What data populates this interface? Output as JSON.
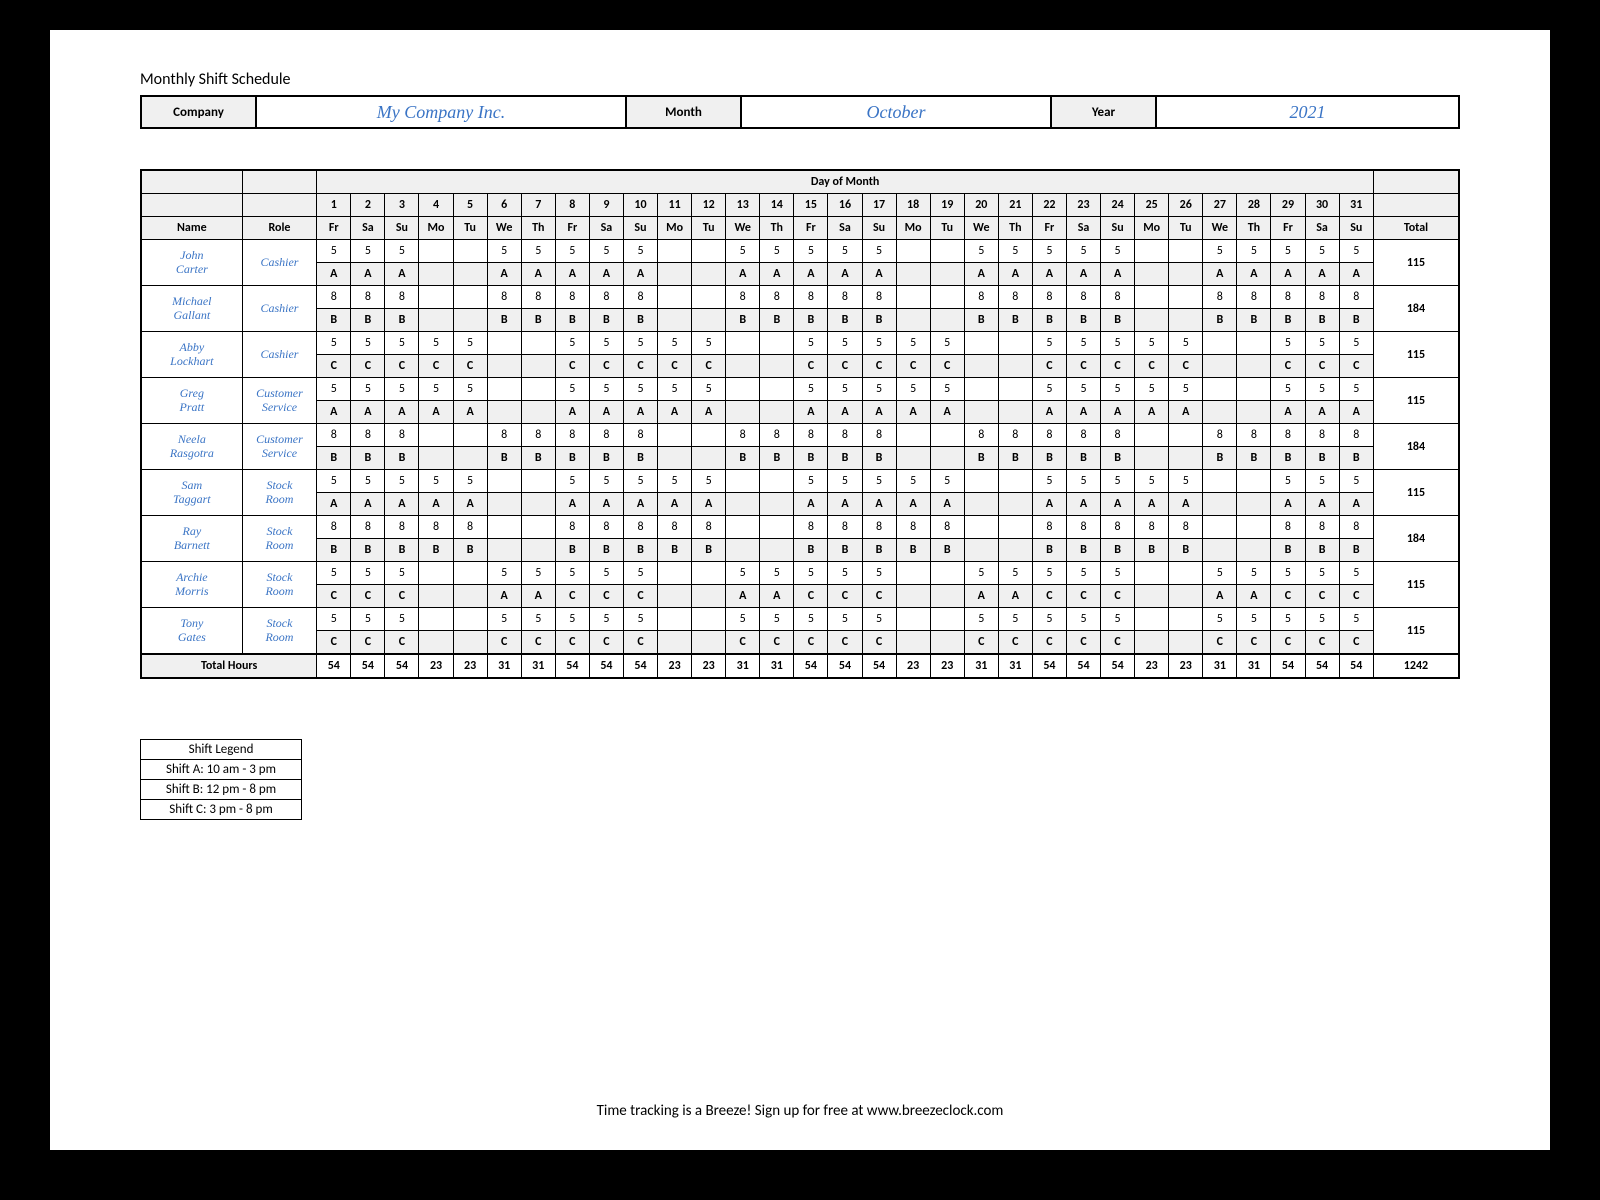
{
  "doc_title": "Monthly Shift Schedule",
  "labels": {
    "company": "Company",
    "month": "Month",
    "year": "Year",
    "day_of_month": "Day of Month",
    "name_hdr": "Name",
    "role_hdr": "Role",
    "total_hdr": "Total",
    "total_hours": "Total Hours"
  },
  "meta": {
    "company": "My Company Inc.",
    "month": "October",
    "year": "2021"
  },
  "days": [
    "1",
    "2",
    "3",
    "4",
    "5",
    "6",
    "7",
    "8",
    "9",
    "10",
    "11",
    "12",
    "13",
    "14",
    "15",
    "16",
    "17",
    "18",
    "19",
    "20",
    "21",
    "22",
    "23",
    "24",
    "25",
    "26",
    "27",
    "28",
    "29",
    "30",
    "31"
  ],
  "weekdays": [
    "Fr",
    "Sa",
    "Su",
    "Mo",
    "Tu",
    "We",
    "Th",
    "Fr",
    "Sa",
    "Su",
    "Mo",
    "Tu",
    "We",
    "Th",
    "Fr",
    "Sa",
    "Su",
    "Mo",
    "Tu",
    "We",
    "Th",
    "Fr",
    "Sa",
    "Su",
    "Mo",
    "Tu",
    "We",
    "Th",
    "Fr",
    "Sa",
    "Su"
  ],
  "employees": [
    {
      "name": "John Carter",
      "role": "Cashier",
      "hours": [
        "5",
        "5",
        "5",
        "",
        "",
        "5",
        "5",
        "5",
        "5",
        "5",
        "",
        "",
        "5",
        "5",
        "5",
        "5",
        "5",
        "",
        "",
        "5",
        "5",
        "5",
        "5",
        "5",
        "",
        "",
        "5",
        "5",
        "5",
        "5",
        "5"
      ],
      "shifts": [
        "A",
        "A",
        "A",
        "",
        "",
        "A",
        "A",
        "A",
        "A",
        "A",
        "",
        "",
        "A",
        "A",
        "A",
        "A",
        "A",
        "",
        "",
        "A",
        "A",
        "A",
        "A",
        "A",
        "",
        "",
        "A",
        "A",
        "A",
        "A",
        "A"
      ],
      "total": "115"
    },
    {
      "name": "Michael Gallant",
      "role": "Cashier",
      "hours": [
        "8",
        "8",
        "8",
        "",
        "",
        "8",
        "8",
        "8",
        "8",
        "8",
        "",
        "",
        "8",
        "8",
        "8",
        "8",
        "8",
        "",
        "",
        "8",
        "8",
        "8",
        "8",
        "8",
        "",
        "",
        "8",
        "8",
        "8",
        "8",
        "8"
      ],
      "shifts": [
        "B",
        "B",
        "B",
        "",
        "",
        "B",
        "B",
        "B",
        "B",
        "B",
        "",
        "",
        "B",
        "B",
        "B",
        "B",
        "B",
        "",
        "",
        "B",
        "B",
        "B",
        "B",
        "B",
        "",
        "",
        "B",
        "B",
        "B",
        "B",
        "B"
      ],
      "total": "184"
    },
    {
      "name": "Abby Lockhart",
      "role": "Cashier",
      "hours": [
        "5",
        "5",
        "5",
        "5",
        "5",
        "",
        "",
        "5",
        "5",
        "5",
        "5",
        "5",
        "",
        "",
        "5",
        "5",
        "5",
        "5",
        "5",
        "",
        "",
        "5",
        "5",
        "5",
        "5",
        "5",
        "",
        "",
        "5",
        "5",
        "5"
      ],
      "shifts": [
        "C",
        "C",
        "C",
        "C",
        "C",
        "",
        "",
        "C",
        "C",
        "C",
        "C",
        "C",
        "",
        "",
        "C",
        "C",
        "C",
        "C",
        "C",
        "",
        "",
        "C",
        "C",
        "C",
        "C",
        "C",
        "",
        "",
        "C",
        "C",
        "C"
      ],
      "total": "115"
    },
    {
      "name": "Greg Pratt",
      "role": "Customer Service",
      "hours": [
        "5",
        "5",
        "5",
        "5",
        "5",
        "",
        "",
        "5",
        "5",
        "5",
        "5",
        "5",
        "",
        "",
        "5",
        "5",
        "5",
        "5",
        "5",
        "",
        "",
        "5",
        "5",
        "5",
        "5",
        "5",
        "",
        "",
        "5",
        "5",
        "5"
      ],
      "shifts": [
        "A",
        "A",
        "A",
        "A",
        "A",
        "",
        "",
        "A",
        "A",
        "A",
        "A",
        "A",
        "",
        "",
        "A",
        "A",
        "A",
        "A",
        "A",
        "",
        "",
        "A",
        "A",
        "A",
        "A",
        "A",
        "",
        "",
        "A",
        "A",
        "A"
      ],
      "total": "115"
    },
    {
      "name": "Neela Rasgotra",
      "role": "Customer Service",
      "hours": [
        "8",
        "8",
        "8",
        "",
        "",
        "8",
        "8",
        "8",
        "8",
        "8",
        "",
        "",
        "8",
        "8",
        "8",
        "8",
        "8",
        "",
        "",
        "8",
        "8",
        "8",
        "8",
        "8",
        "",
        "",
        "8",
        "8",
        "8",
        "8",
        "8"
      ],
      "shifts": [
        "B",
        "B",
        "B",
        "",
        "",
        "B",
        "B",
        "B",
        "B",
        "B",
        "",
        "",
        "B",
        "B",
        "B",
        "B",
        "B",
        "",
        "",
        "B",
        "B",
        "B",
        "B",
        "B",
        "",
        "",
        "B",
        "B",
        "B",
        "B",
        "B"
      ],
      "total": "184"
    },
    {
      "name": "Sam Taggart",
      "role": "Stock Room",
      "hours": [
        "5",
        "5",
        "5",
        "5",
        "5",
        "",
        "",
        "5",
        "5",
        "5",
        "5",
        "5",
        "",
        "",
        "5",
        "5",
        "5",
        "5",
        "5",
        "",
        "",
        "5",
        "5",
        "5",
        "5",
        "5",
        "",
        "",
        "5",
        "5",
        "5"
      ],
      "shifts": [
        "A",
        "A",
        "A",
        "A",
        "A",
        "",
        "",
        "A",
        "A",
        "A",
        "A",
        "A",
        "",
        "",
        "A",
        "A",
        "A",
        "A",
        "A",
        "",
        "",
        "A",
        "A",
        "A",
        "A",
        "A",
        "",
        "",
        "A",
        "A",
        "A"
      ],
      "total": "115"
    },
    {
      "name": "Ray Barnett",
      "role": "Stock Room",
      "hours": [
        "8",
        "8",
        "8",
        "8",
        "8",
        "",
        "",
        "8",
        "8",
        "8",
        "8",
        "8",
        "",
        "",
        "8",
        "8",
        "8",
        "8",
        "8",
        "",
        "",
        "8",
        "8",
        "8",
        "8",
        "8",
        "",
        "",
        "8",
        "8",
        "8"
      ],
      "shifts": [
        "B",
        "B",
        "B",
        "B",
        "B",
        "",
        "",
        "B",
        "B",
        "B",
        "B",
        "B",
        "",
        "",
        "B",
        "B",
        "B",
        "B",
        "B",
        "",
        "",
        "B",
        "B",
        "B",
        "B",
        "B",
        "",
        "",
        "B",
        "B",
        "B"
      ],
      "total": "184"
    },
    {
      "name": "Archie Morris",
      "role": "Stock Room",
      "hours": [
        "5",
        "5",
        "5",
        "",
        "",
        "5",
        "5",
        "5",
        "5",
        "5",
        "",
        "",
        "5",
        "5",
        "5",
        "5",
        "5",
        "",
        "",
        "5",
        "5",
        "5",
        "5",
        "5",
        "",
        "",
        "5",
        "5",
        "5",
        "5",
        "5"
      ],
      "shifts": [
        "C",
        "C",
        "C",
        "",
        "",
        "A",
        "A",
        "C",
        "C",
        "C",
        "",
        "",
        "A",
        "A",
        "C",
        "C",
        "C",
        "",
        "",
        "A",
        "A",
        "C",
        "C",
        "C",
        "",
        "",
        "A",
        "A",
        "C",
        "C",
        "C"
      ],
      "total": "115"
    },
    {
      "name": "Tony Gates",
      "role": "Stock Room",
      "hours": [
        "5",
        "5",
        "5",
        "",
        "",
        "5",
        "5",
        "5",
        "5",
        "5",
        "",
        "",
        "5",
        "5",
        "5",
        "5",
        "5",
        "",
        "",
        "5",
        "5",
        "5",
        "5",
        "5",
        "",
        "",
        "5",
        "5",
        "5",
        "5",
        "5"
      ],
      "shifts": [
        "C",
        "C",
        "C",
        "",
        "",
        "C",
        "C",
        "C",
        "C",
        "C",
        "",
        "",
        "C",
        "C",
        "C",
        "C",
        "C",
        "",
        "",
        "C",
        "C",
        "C",
        "C",
        "C",
        "",
        "",
        "C",
        "C",
        "C",
        "C",
        "C"
      ],
      "total": "115"
    }
  ],
  "daily_totals": [
    "54",
    "54",
    "54",
    "23",
    "23",
    "31",
    "31",
    "54",
    "54",
    "54",
    "23",
    "23",
    "31",
    "31",
    "54",
    "54",
    "54",
    "23",
    "23",
    "31",
    "31",
    "54",
    "54",
    "54",
    "23",
    "23",
    "31",
    "31",
    "54",
    "54",
    "54"
  ],
  "grand_total": "1242",
  "legend": {
    "title": "Shift Legend",
    "rows": [
      "Shift A: 10 am - 3 pm",
      "Shift B: 12 pm - 8 pm",
      "Shift C: 3 pm - 8 pm"
    ]
  },
  "footer": "Time tracking is a Breeze! Sign up for free at www.breezeclock.com"
}
